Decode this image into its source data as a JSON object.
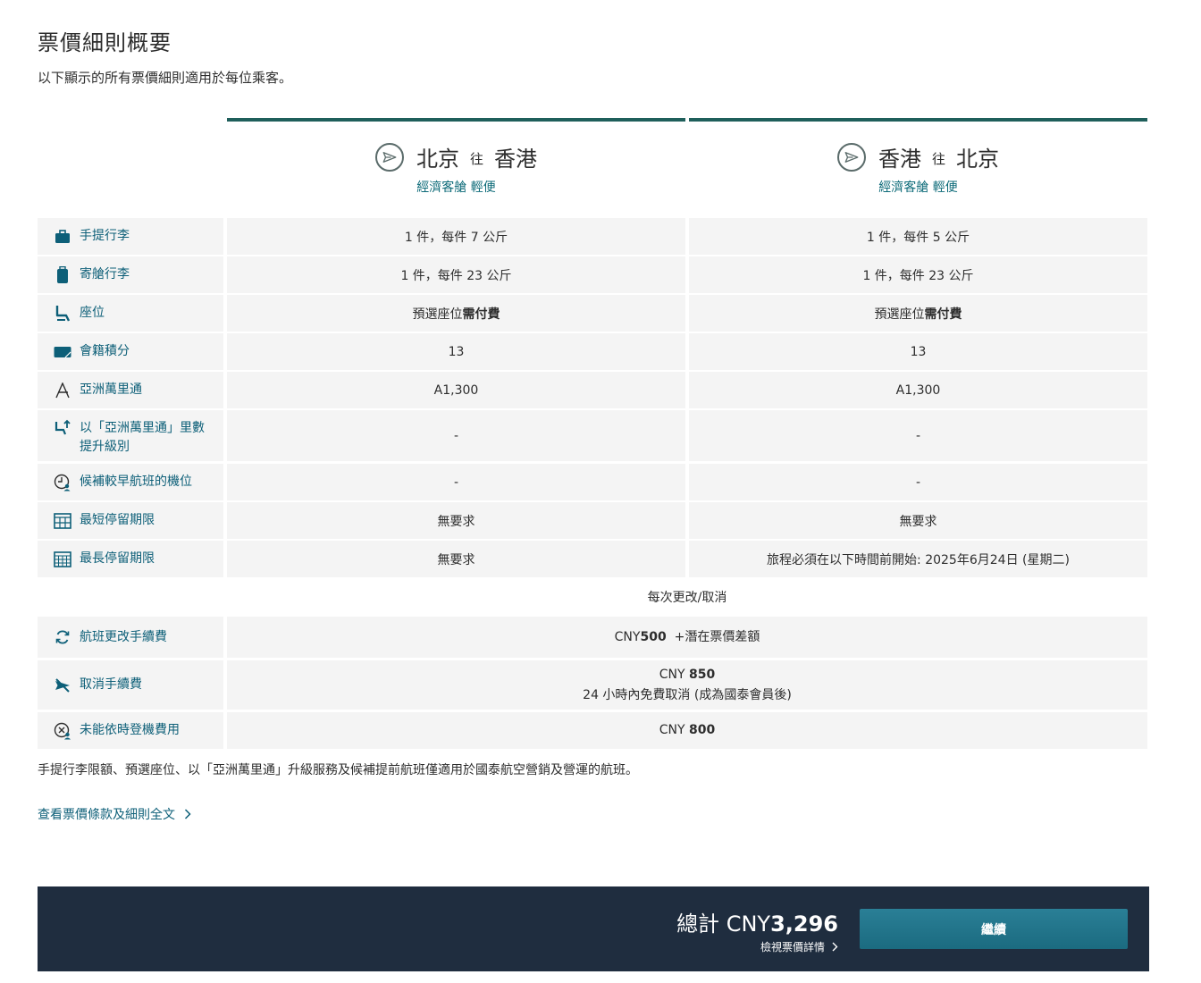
{
  "header": {
    "title": "票價細則概要",
    "subtitle": "以下顯示的所有票價細則適用於每位乘客。"
  },
  "routes": [
    {
      "from": "北京",
      "to_word": "往",
      "to": "香港",
      "cabin": "經濟客艙 輕便",
      "icon": "plane-icon"
    },
    {
      "from": "香港",
      "to_word": "往",
      "to": "北京",
      "cabin": "經濟客艙 輕便",
      "icon": "plane-icon"
    }
  ],
  "rows": [
    {
      "label": "手提行李",
      "icon": "carry-on-bag-icon",
      "out": "1 件，每件 7 公斤",
      "ret": "1 件，每件 5 公斤"
    },
    {
      "label": "寄艙行李",
      "icon": "checked-bag-icon",
      "out": "1 件，每件 23 公斤",
      "ret": "1 件，每件 23 公斤"
    },
    {
      "label": "座位",
      "icon": "seat-icon",
      "out_a": "預選座位",
      "out_b": "需付費",
      "ret_a": "預選座位",
      "ret_b": "需付費"
    },
    {
      "label": "會籍積分",
      "icon": "membership-card-icon",
      "out": "13",
      "ret": "13"
    },
    {
      "label": "亞洲萬里通",
      "icon": "asia-miles-icon",
      "out": "A1,300",
      "ret": "A1,300"
    },
    {
      "label": "以「亞洲萬里通」里數提升級別",
      "icon": "upgrade-seat-icon",
      "out": "-",
      "ret": "-"
    },
    {
      "label": "候補較早航班的機位",
      "icon": "standby-clock-icon",
      "out": "-",
      "ret": "-"
    },
    {
      "label": "最短停留期限",
      "icon": "calendar-min-icon",
      "out": "無要求",
      "ret": "無要求"
    },
    {
      "label": "最長停留期限",
      "icon": "calendar-max-icon",
      "out": "無要求",
      "ret": "旅程必須在以下時間前開始: 2025年6月24日 (星期二)"
    }
  ],
  "change_section": {
    "heading": "每次更改/取消",
    "rows": [
      {
        "label": "航班更改手續費",
        "icon": "refresh-icon",
        "currency": "CNY",
        "amount": "500",
        "extra": "+潛在票價差額"
      },
      {
        "label": "取消手續費",
        "icon": "cancel-flight-icon",
        "currency": "CNY ",
        "amount": "850",
        "extra": "24 小時內免費取消 (成為國泰會員後)"
      },
      {
        "label": "未能依時登機費用",
        "icon": "no-show-icon",
        "currency": "CNY ",
        "amount": "800"
      }
    ]
  },
  "footnote": "手提行李限額、預選座位、以「亞洲萬里通」升級服務及候補提前航班僅適用於國泰航空營銷及營運的航班。",
  "full_terms_link": "查看票價條款及細則全文",
  "footer": {
    "total_label": "總計",
    "currency": "CNY",
    "amount": "3,296",
    "detail_link": "檢視票價詳情",
    "continue_label": "繼續"
  },
  "colors": {
    "accent_teal": "#1f5f5b",
    "label_blue": "#0d5f78",
    "footer_bg": "#1f2d3f",
    "button": "#1b6b80",
    "row_bg": "#f4f4f4"
  }
}
